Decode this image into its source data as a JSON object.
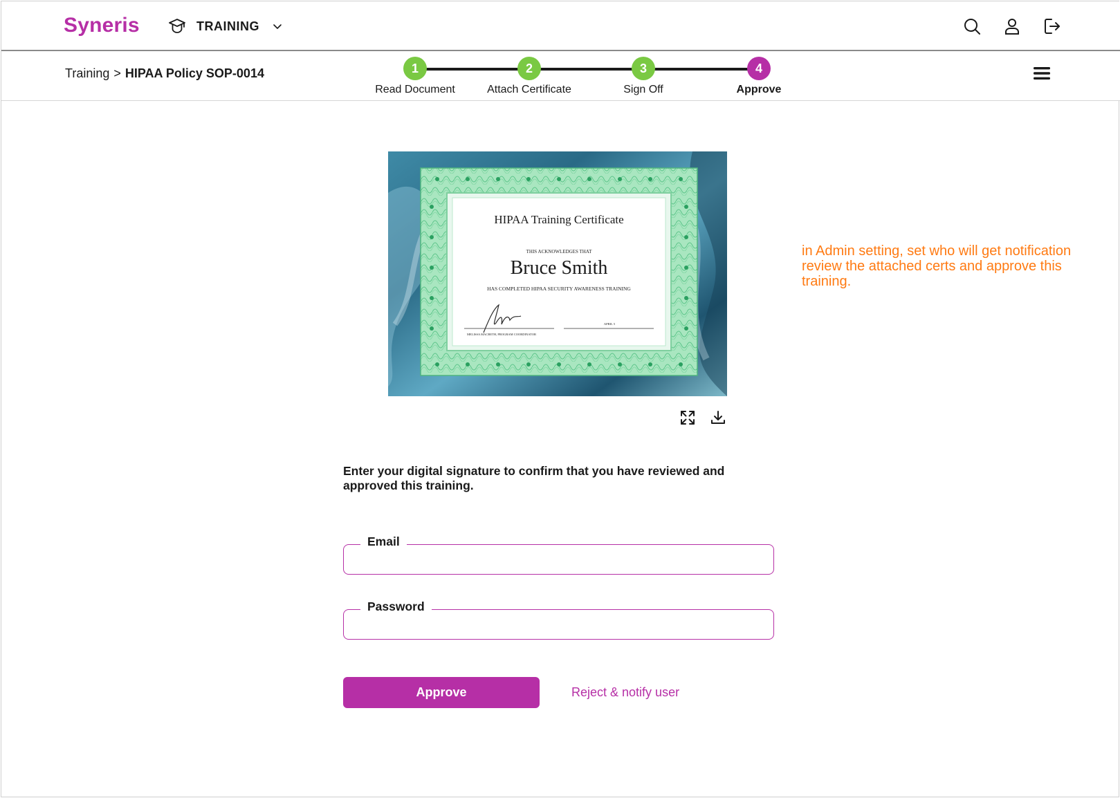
{
  "brand": {
    "name": "Syneris",
    "color": "#b62fa6"
  },
  "header": {
    "module_label": "TRAINING",
    "module_icon": "graduation-cap-icon",
    "icons": [
      "search-icon",
      "user-icon",
      "logout-icon"
    ]
  },
  "breadcrumb": {
    "parent": "Training",
    "separator": ">",
    "current": "HIPAA Policy SOP-0014"
  },
  "stepper": {
    "steps": [
      {
        "number": "1",
        "label": "Read Document",
        "state": "done"
      },
      {
        "number": "2",
        "label": "Attach Certificate",
        "state": "done"
      },
      {
        "number": "3",
        "label": "Sign Off",
        "state": "done"
      },
      {
        "number": "4",
        "label": "Approve",
        "state": "active"
      }
    ],
    "done_color": "#7ac943",
    "active_color": "#b62fa6"
  },
  "certificate": {
    "title": "HIPAA Training Certificate",
    "acknowledges": "THIS ACKNOWLEDGES THAT",
    "name": "Bruce Smith",
    "completed": "HAS COMPLETED HIPAA SECURITY AWARENESS TRAINING",
    "signer": "MELISSA MACBETH, PROGRAM COORDINATOR",
    "date": "APRIL 5",
    "actions": [
      "expand-icon",
      "download-icon"
    ]
  },
  "form": {
    "instruction": "Enter your digital signature to confirm that you have reviewed and approved this training.",
    "email_label": "Email",
    "email_value": "",
    "password_label": "Password",
    "password_value": "",
    "approve_label": "Approve",
    "reject_label": "Reject & notify user"
  },
  "annotation": {
    "text": "in Admin setting, set who will get notification review the attached certs and approve this training.",
    "color": "#ff7a12"
  }
}
